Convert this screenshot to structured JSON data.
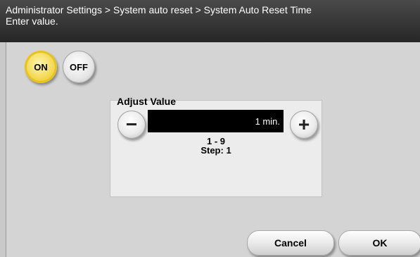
{
  "header": {
    "breadcrumb": "Administrator Settings > System auto reset > System Auto Reset Time",
    "instruction": "Enter value."
  },
  "toggle": {
    "on_label": "ON",
    "off_label": "OFF",
    "selected": "ON"
  },
  "adjust": {
    "title": "Adjust Value",
    "minus_symbol": "−",
    "plus_symbol": "+",
    "value": "1 min.",
    "range": "1 - 9",
    "step": "Step: 1"
  },
  "footer": {
    "cancel_label": "Cancel",
    "ok_label": "OK"
  }
}
